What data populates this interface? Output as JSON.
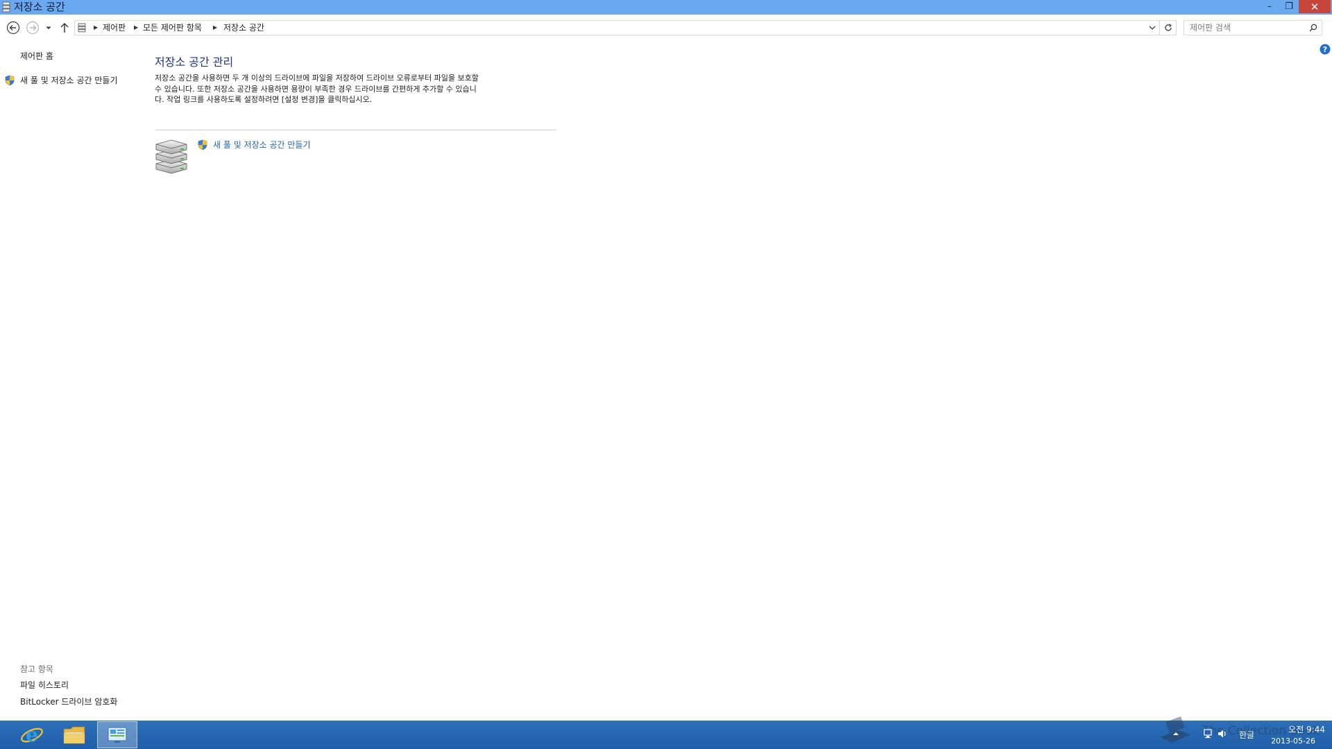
{
  "window": {
    "title": "저장소 공간",
    "minimize_label": "–",
    "restore_label": "❐",
    "close_label": "✕"
  },
  "nav": {
    "breadcrumbs": [
      "제어판",
      "모든 제어판 항목",
      "저장소 공간"
    ],
    "search_placeholder": "제어판 검색"
  },
  "sidebar": {
    "home": "제어판 홈",
    "create_pool": "새 풀 및 저장소 공간 만들기",
    "see_also_title": "참고 항목",
    "see_also_items": [
      "파일 히스토리",
      "BitLocker 드라이브 암호화"
    ]
  },
  "main": {
    "title": "저장소 공간 관리",
    "description": "저장소 공간을 사용하면 두 개 이상의 드라이브에 파일을 저장하여 드라이브 오류로부터 파일을 보호할 수 있습니다. 또한 저장소 공간을 사용하면 용량이 부족한 경우 드라이브를 간편하게 추가할 수 있습니다. 작업 링크를 사용하도록 설정하려면 [설정 변경]을 클릭하십시오.",
    "create_link": "새 풀 및 저장소 공간 만들기"
  },
  "taskbar": {
    "ime_label": "한글",
    "time": "오전 9:44",
    "date": "2013-05-26",
    "watermark": "The Collection Book"
  },
  "colors": {
    "titlebar": "#6aa9f0",
    "close_button": "#c7453b",
    "link": "#1e64b4",
    "heading": "#1e3287",
    "taskbar": "#1f5ea8"
  }
}
